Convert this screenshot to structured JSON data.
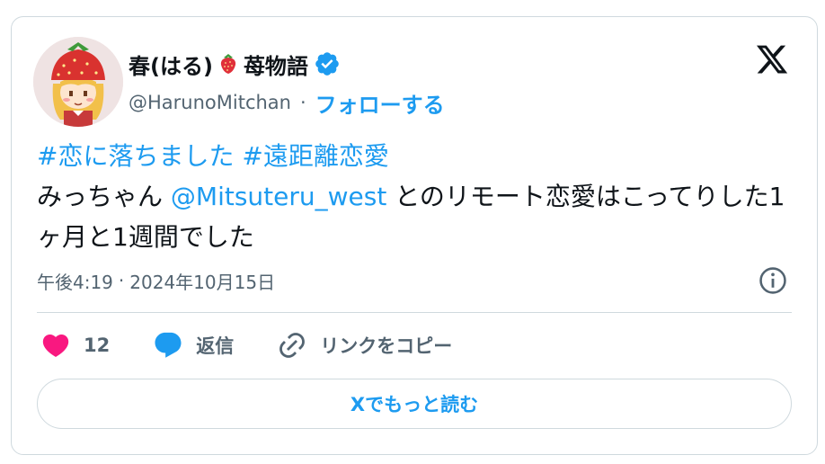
{
  "author": {
    "display_name": "春(はる)",
    "display_name_suffix": "苺物語",
    "handle": "@HarunoMitchan",
    "handle_separator": "·",
    "follow_label": "フォローする",
    "verified": true
  },
  "tweet": {
    "hashtag_1": "#恋に落ちました",
    "hashtag_2": "#遠距離恋愛",
    "text_before_mention": "みっちゃん ",
    "mention": "@Mitsuteru_west",
    "text_after_mention": " とのリモート恋愛はこってりした1ヶ月と1週間でした"
  },
  "meta": {
    "time": "午後4:19",
    "separator": "·",
    "date": "2024年10月15日"
  },
  "actions": {
    "like_count": "12",
    "reply_label": "返信",
    "copy_link_label": "リンクをコピー"
  },
  "read_more_label": "Xでもっと読む",
  "colors": {
    "accent": "#1d9bf0",
    "like": "#f91880",
    "text_primary": "#0f1419",
    "text_secondary": "#536471",
    "border": "#cfd9de"
  },
  "icons": {
    "avatar": "strawberry-hat-girl-avatar",
    "strawberry": "strawberry-icon",
    "verified": "verified-badge-icon",
    "logo": "x-logo-icon",
    "info": "info-icon",
    "like": "heart-icon",
    "reply": "speech-bubble-icon",
    "copy_link": "link-icon"
  }
}
